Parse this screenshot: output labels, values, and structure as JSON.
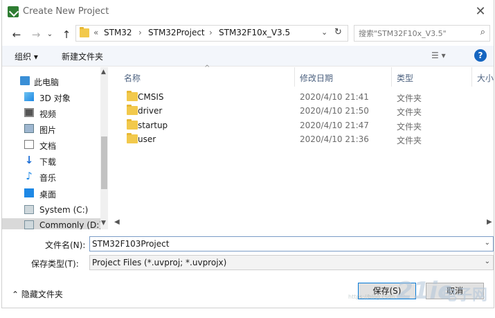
{
  "window": {
    "title": "Create New Project"
  },
  "address": {
    "overflow": "«",
    "crumbs": [
      "STM32",
      "STM32Project",
      "STM32F10x_V3.5"
    ]
  },
  "search": {
    "placeholder": "搜索\"STM32F10x_V3.5\""
  },
  "toolbar": {
    "organize": "组织 ▾",
    "new_folder": "新建文件夹"
  },
  "nav": {
    "items": [
      {
        "label": "此电脑",
        "icon": "computer-icon"
      },
      {
        "label": "3D 对象",
        "icon": "cube-icon"
      },
      {
        "label": "视频",
        "icon": "video-icon"
      },
      {
        "label": "图片",
        "icon": "pictures-icon"
      },
      {
        "label": "文档",
        "icon": "document-icon"
      },
      {
        "label": "下载",
        "icon": "download-icon"
      },
      {
        "label": "音乐",
        "icon": "music-icon"
      },
      {
        "label": "桌面",
        "icon": "desktop-icon"
      },
      {
        "label": "System (C:)",
        "icon": "drive-icon"
      },
      {
        "label": "Commonly (D:)",
        "icon": "drive-icon"
      }
    ]
  },
  "columns": {
    "name": "名称",
    "modified": "修改日期",
    "type": "类型",
    "size": "大小"
  },
  "files": [
    {
      "name": "CMSIS",
      "modified": "2020/4/10 21:41",
      "type": "文件夹"
    },
    {
      "name": "driver",
      "modified": "2020/4/10 21:50",
      "type": "文件夹"
    },
    {
      "name": "startup",
      "modified": "2020/4/10 21:47",
      "type": "文件夹"
    },
    {
      "name": "user",
      "modified": "2020/4/10 21:36",
      "type": "文件夹"
    }
  ],
  "form": {
    "filename_label": "文件名(N):",
    "filename_value": "STM32F103Project",
    "filetype_label": "保存类型(T):",
    "filetype_value": "Project Files (*.uvproj; *.uvprojx)"
  },
  "footer": {
    "hide_folders": "隐藏文件夹",
    "save": "保存(S)",
    "cancel": "取消"
  },
  "watermark": {
    "brand": "21ic",
    "text": "电子网",
    "url": "https://blog.csdn.net"
  }
}
